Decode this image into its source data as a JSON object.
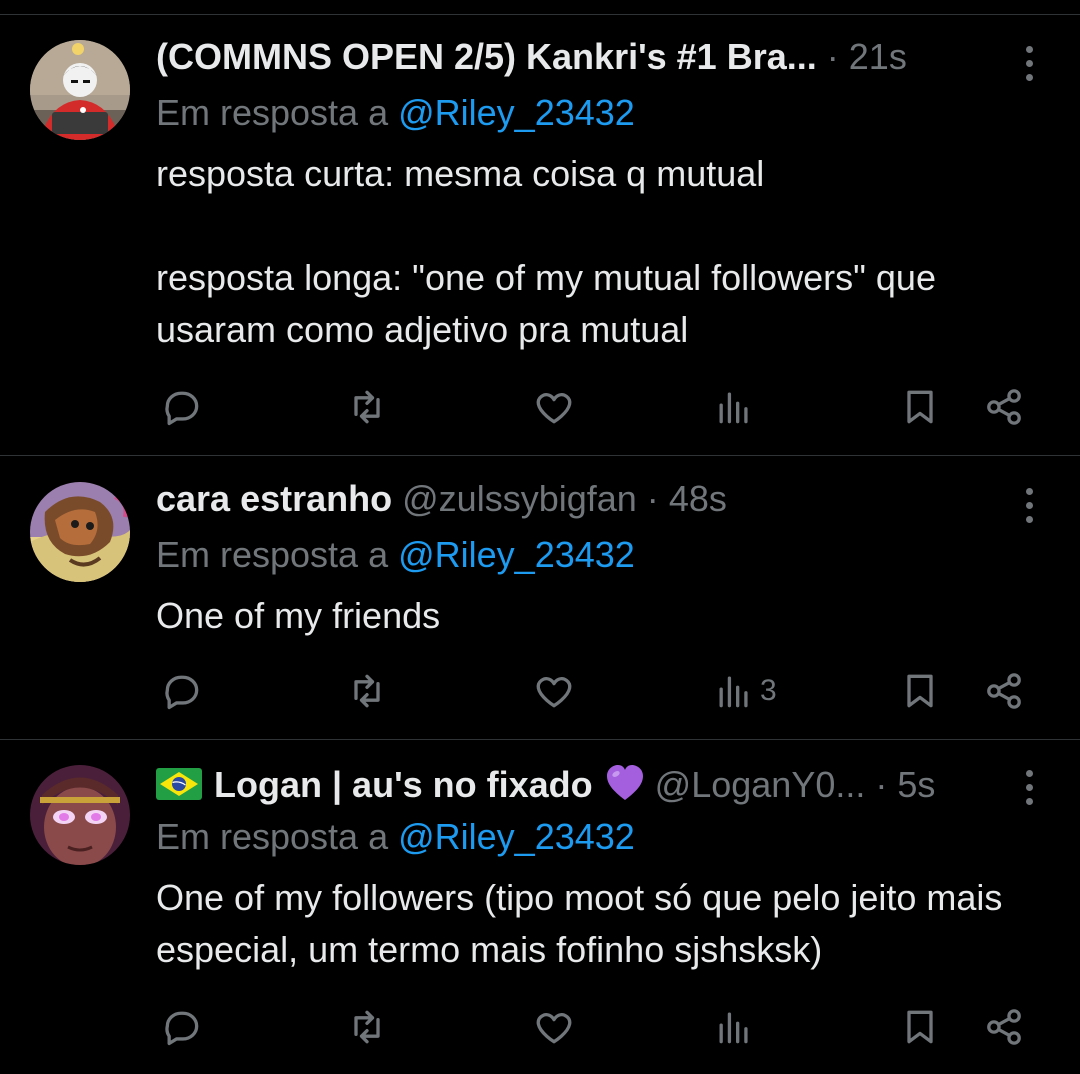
{
  "tweets": [
    {
      "name": "(COMMNS OPEN 2/5) Kankri's #1 Bra...",
      "handle": "",
      "dot": "·",
      "time": "21s",
      "reply_prefix": "Em resposta a ",
      "reply_to": "@Riley_23432",
      "text": "resposta curta: mesma coisa q mutual\n\nresposta longa: \"one of my mutual followers\" que usaram como adjetivo pra mutual",
      "views": ""
    },
    {
      "name": "cara estranho",
      "handle": "@zulssybigfan",
      "dot": "·",
      "time": "48s",
      "reply_prefix": "Em resposta a ",
      "reply_to": "@Riley_23432",
      "text": "One of my friends",
      "views": "3"
    },
    {
      "name": "Logan | au's no fixado",
      "handle": "@LoganY0...",
      "dot": "·",
      "time": "5s",
      "reply_prefix": "Em resposta a ",
      "reply_to": "@Riley_23432",
      "text": "One of my followers (tipo moot só que pelo jeito mais especial, um termo mais fofinho sjshsksk)",
      "views": ""
    }
  ],
  "icons": {
    "reply": "reply-icon",
    "retweet": "retweet-icon",
    "like": "heart-icon",
    "views": "views-icon",
    "bookmark": "bookmark-icon",
    "share": "share-icon",
    "more": "more-options-icon"
  },
  "colors": {
    "background": "#000000",
    "text": "#e7e9ea",
    "muted": "#71767b",
    "mention": "#1d9bf0",
    "divider": "#2f3336"
  }
}
